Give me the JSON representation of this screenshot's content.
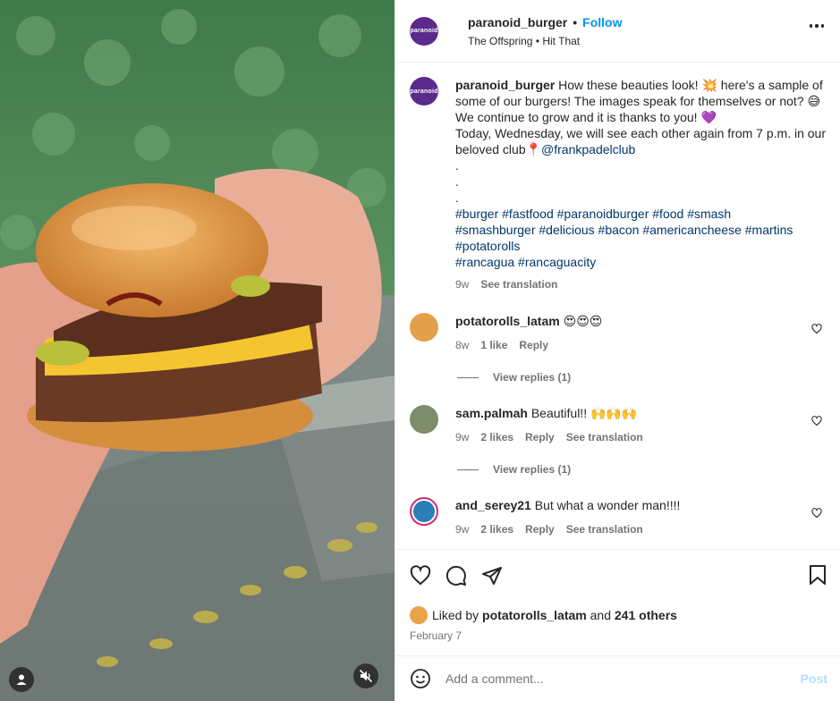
{
  "post": {
    "username": "paranoid_burger",
    "avatar_text": "paranoid",
    "follow_label": "Follow",
    "audio": "The Offspring • Hit That"
  },
  "caption": {
    "username": "paranoid_burger",
    "line1": "How these beauties look! 💥 here's a sample of some of our burgers! The images speak for themselves or not? 😅",
    "line2": "We continue to grow and it is thanks to you! 💜",
    "line3": "Today, Wednesday, we will see each other again from 7 p.m. in our beloved club📍",
    "mention": "@frankpadelclub",
    "dots": [
      ".",
      ".",
      "."
    ],
    "hashtags_line1": "#burger #fastfood #paranoidburger #food #smash",
    "hashtags_line2": "#smashburger #delicious #bacon #americancheese #martins",
    "hashtags_line3": "#potatorolls",
    "hashtags_line4": "#rancagua #rancaguacity",
    "time": "9w",
    "translate": "See translation"
  },
  "comments": [
    {
      "username": "potatorolls_latam",
      "text": "😍😍😍",
      "time": "8w",
      "likes": "1 like",
      "reply": "Reply",
      "view_replies": "View replies (1)",
      "avatar_color": "#e3a04a"
    },
    {
      "username": "sam.palmah",
      "text": "Beautiful!! 🙌🙌🙌",
      "time": "9w",
      "likes": "2 likes",
      "reply": "Reply",
      "translate": "See translation",
      "view_replies": "View replies (1)",
      "avatar_color": "#7d8c6a"
    },
    {
      "username": "and_serey21",
      "text": "But what a wonder man!!!!",
      "time": "9w",
      "likes": "2 likes",
      "reply": "Reply",
      "translate": "See translation",
      "avatar_color": "#2a7fb8"
    }
  ],
  "likes": {
    "prefix": "Liked by",
    "user": "potatorolls_latam",
    "and": "and",
    "others": "241 others"
  },
  "date": "February 7",
  "add_comment": {
    "placeholder": "Add a comment...",
    "post_label": "Post"
  },
  "colors": {
    "accent": "#0095f6",
    "link": "#00376b",
    "muted": "#737373",
    "brand_avatar": "#5b2a8c"
  },
  "icons": [
    "heart-icon",
    "comment-icon",
    "share-icon",
    "bookmark-icon",
    "emoji-icon",
    "more-icon",
    "user-tag-icon",
    "mute-icon"
  ]
}
